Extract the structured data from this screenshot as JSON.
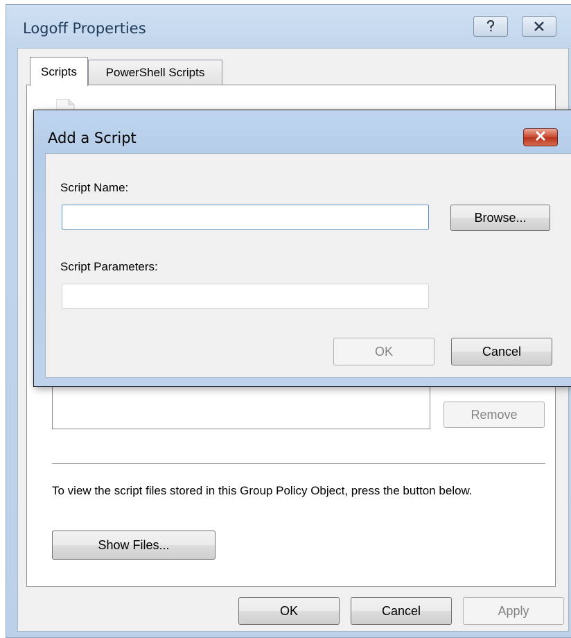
{
  "main_window": {
    "title": "Logoff Properties",
    "tabs": [
      {
        "label": "Scripts",
        "active": true
      },
      {
        "label": "PowerShell Scripts",
        "active": false
      }
    ],
    "remove_label": "Remove",
    "info_text": "To view the script files stored in this Group Policy Object, press the button below.",
    "show_files_label": "Show Files...",
    "ok_label": "OK",
    "cancel_label": "Cancel",
    "apply_label": "Apply"
  },
  "dialog": {
    "title": "Add a Script",
    "script_name_label": "Script Name:",
    "script_name_value": "",
    "browse_label": "Browse...",
    "script_params_label": "Script Parameters:",
    "script_params_value": "",
    "ok_label": "OK",
    "cancel_label": "Cancel"
  },
  "icons": {
    "help": "help-icon",
    "close": "close-icon",
    "file": "file-icon"
  },
  "colors": {
    "title_bar": "#c2d6ec",
    "dialog_close": "#c9472f",
    "client_bg": "#f0f0f0"
  }
}
